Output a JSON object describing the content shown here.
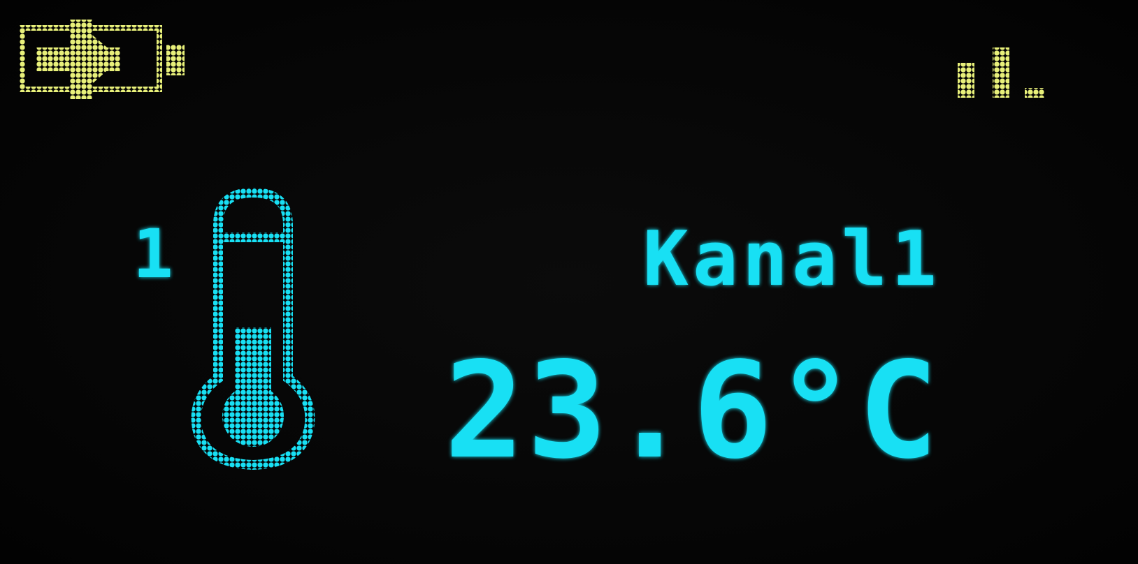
{
  "colors": {
    "primary": "#18e0f4",
    "status": "#e8f07a",
    "background": "#050505"
  },
  "status_bar": {
    "power_icon": "plug-battery-icon",
    "signal_icon": "signal-strength-icon",
    "signal_level": 0.67
  },
  "main": {
    "channel_number": "1",
    "thermometer_icon": "thermometer-icon",
    "thermometer_fill_level": 0.5,
    "channel_name": "Kanal1",
    "temperature": "23.6°C"
  }
}
